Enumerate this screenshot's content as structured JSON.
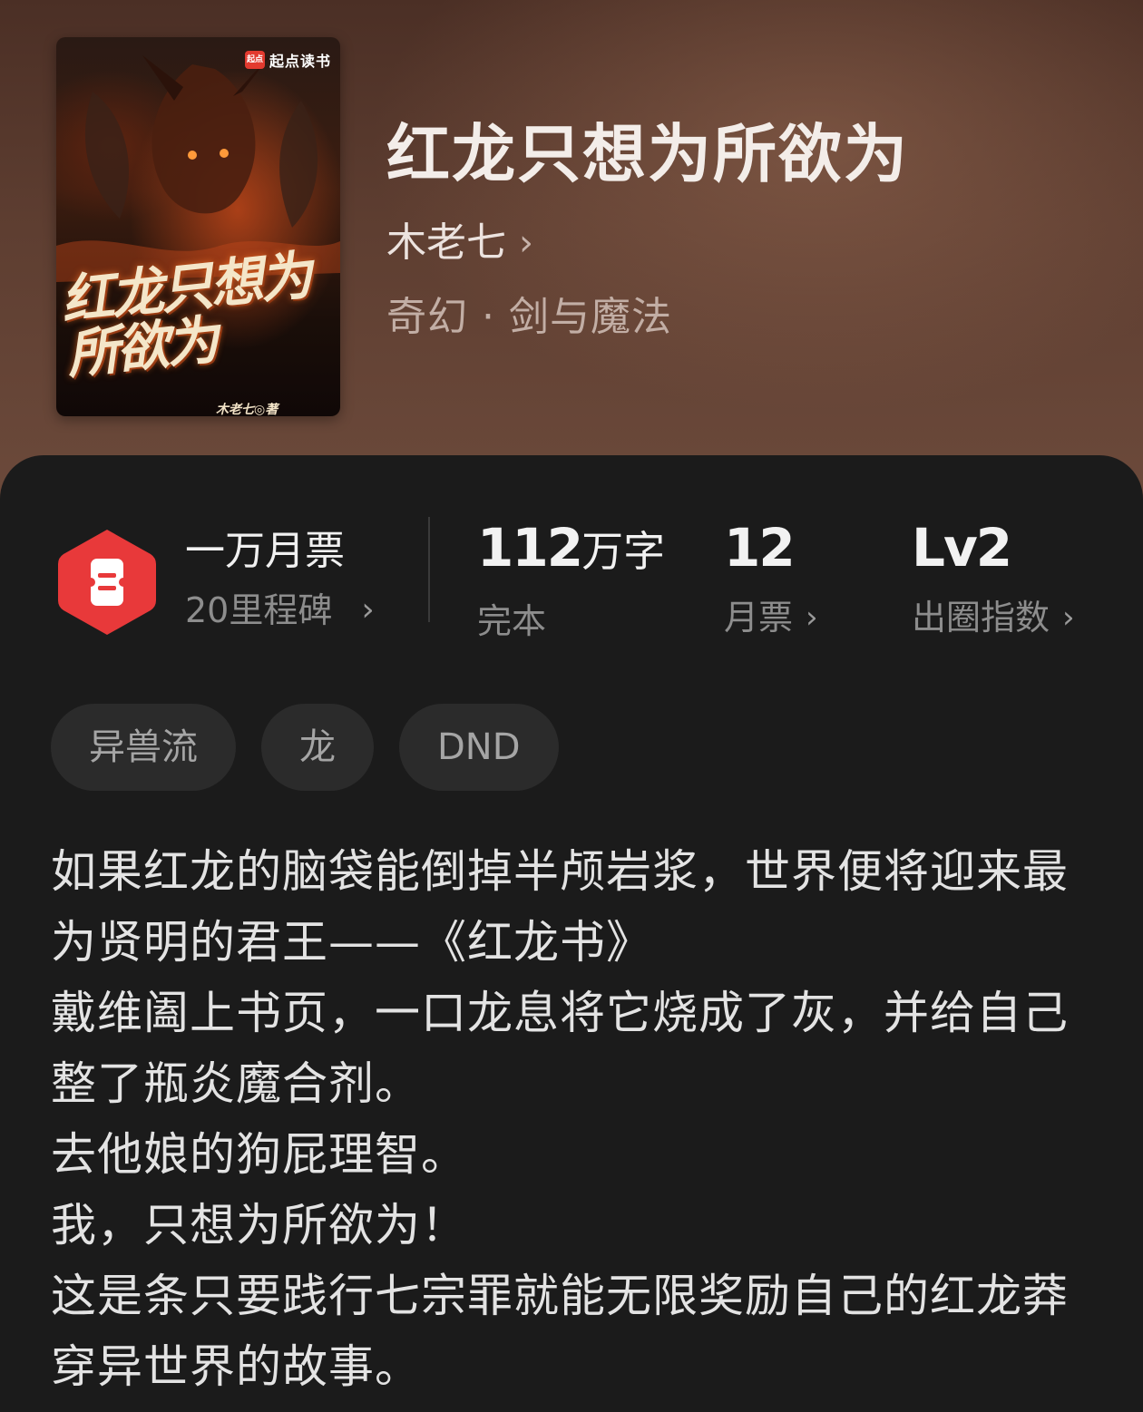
{
  "book": {
    "title": "红龙只想为所欲为",
    "author": "木老七",
    "genre": "奇幻 · 剑与魔法",
    "cover": {
      "brand": "起点读书",
      "brand_mark": "起点",
      "title": "红龙只想为所欲为",
      "author_credit": "木老七◎著"
    }
  },
  "stats": {
    "monthly_ticket": {
      "title": "一万月票",
      "subtitle": "20里程碑",
      "icon": "ticket-icon",
      "icon_color": "#e8393a"
    },
    "word_count": {
      "number": "112",
      "unit": "万字",
      "label": "完本"
    },
    "tickets": {
      "value": "12",
      "label": "月票"
    },
    "index": {
      "value": "Lv2",
      "label": "出圈指数"
    }
  },
  "tags": [
    "异兽流",
    "龙",
    "DND"
  ],
  "description": [
    "如果红龙的脑袋能倒掉半颅岩浆，世界便将迎来最为贤明的君王——《红龙书》",
    "戴维阖上书页，一口龙息将它烧成了灰，并给自己整了瓶炎魔合剂。",
    "去他娘的狗屁理智。",
    "我，只想为所欲为！",
    "这是条只要践行七宗罪就能无限奖励自己的红龙莽穿异世界的故事。"
  ]
}
